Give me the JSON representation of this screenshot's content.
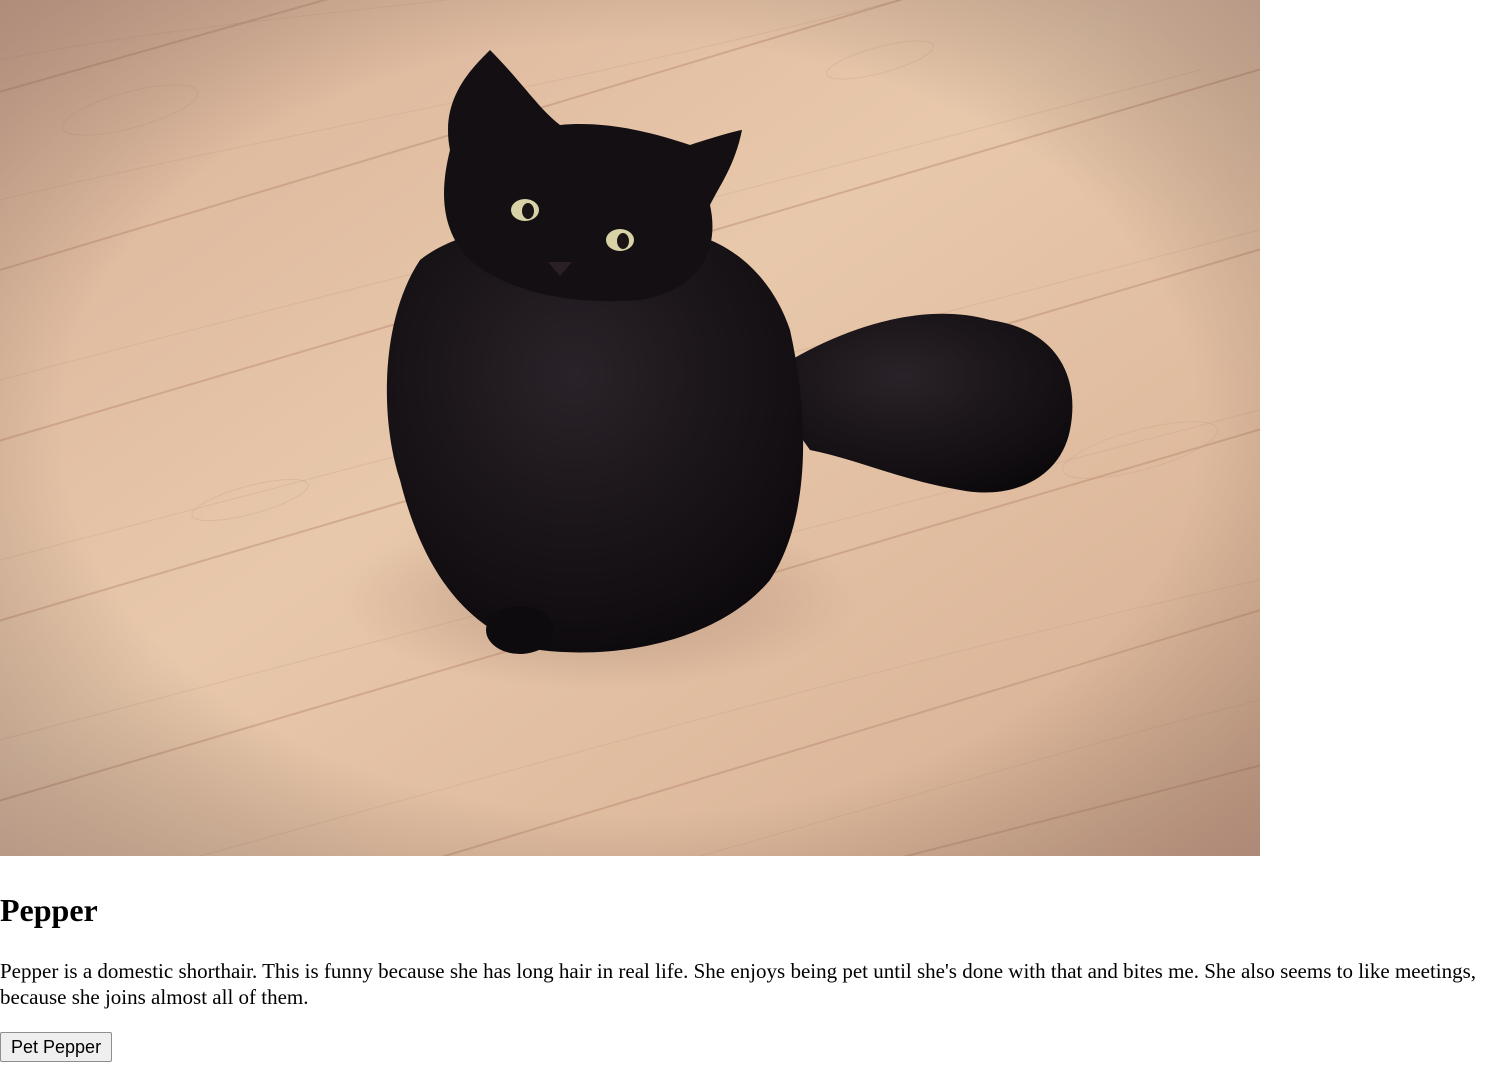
{
  "cat": {
    "name": "Pepper",
    "description": "Pepper is a domestic shorthair. This is funny because she has long hair in real life. She enjoys being pet until she's done with that and bites me. She also seems to like meetings, because she joins almost all of them.",
    "button_label": "Pet Pepper"
  },
  "photo": {
    "subject": "black-cat-on-wood-floor",
    "colors": {
      "floor_light": "#e9c9ac",
      "floor_mid": "#d6ab8a",
      "floor_dark": "#b98a70",
      "fur": "#141015",
      "eyes": "#d8d2a6"
    }
  }
}
